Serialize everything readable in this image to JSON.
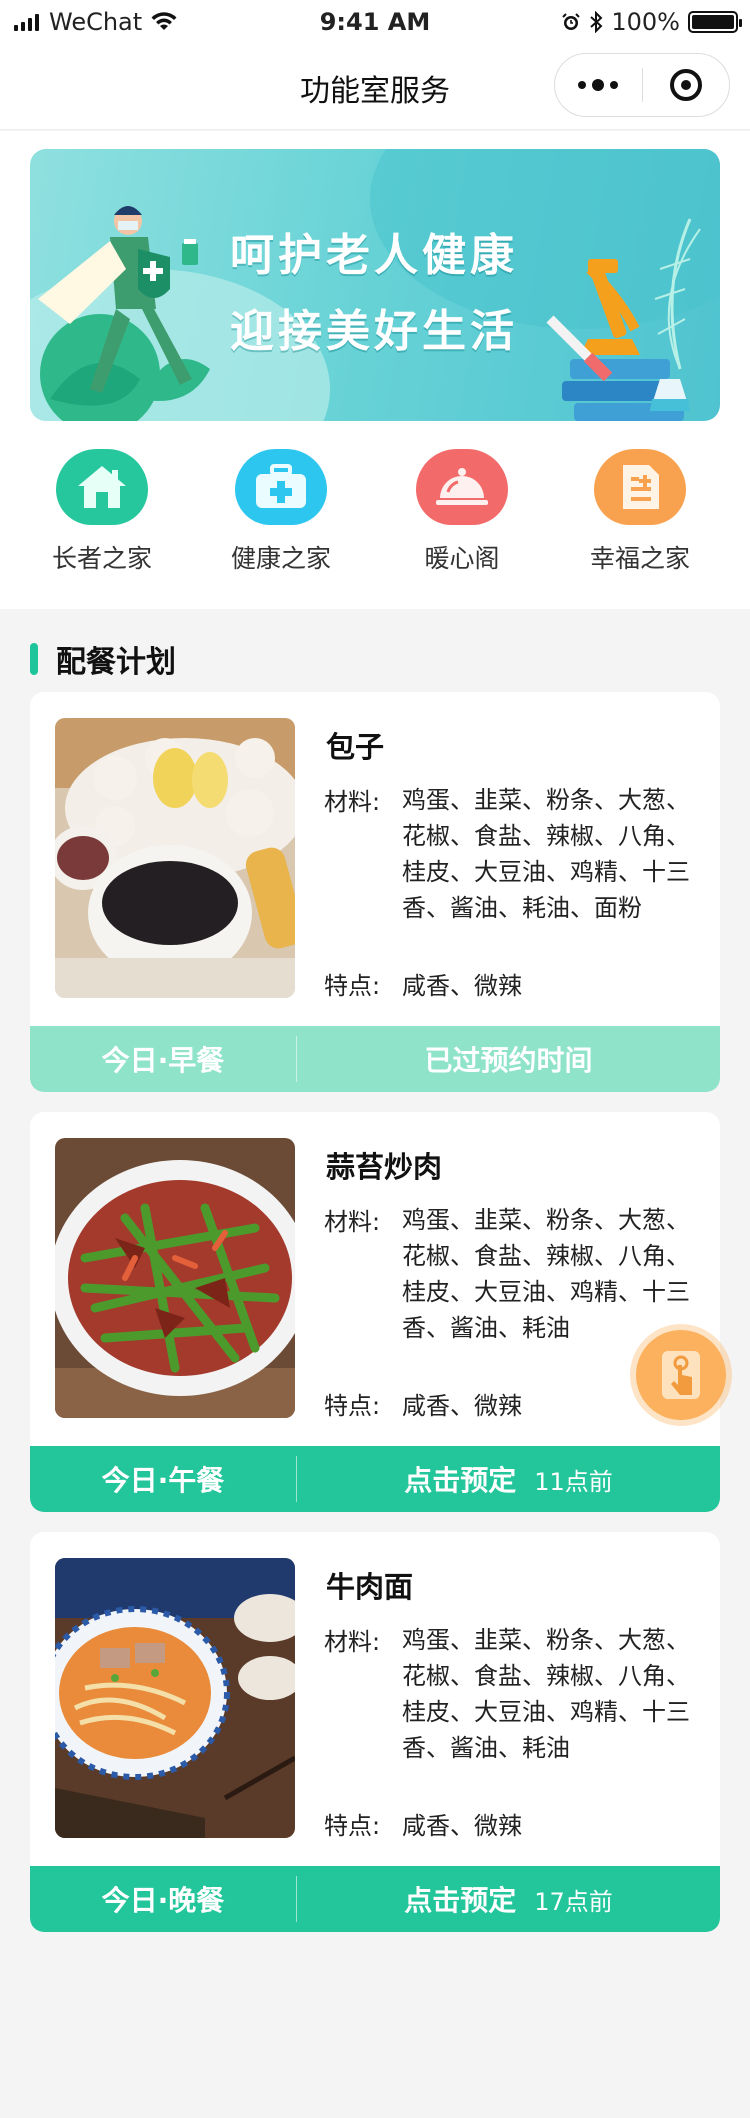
{
  "status_bar": {
    "carrier": "WeChat",
    "time": "9:41 AM",
    "battery": "100%",
    "battery_level": 1.0
  },
  "nav": {
    "title": "功能室服务"
  },
  "banner": {
    "line1": "呵护老人健康",
    "line2": "迎接美好生活"
  },
  "categories": [
    {
      "label": "长者之家",
      "icon": "house-icon",
      "color": "#26c79c"
    },
    {
      "label": "健康之家",
      "icon": "first-aid-kit-icon",
      "color": "#2cc6ee"
    },
    {
      "label": "暖心阁",
      "icon": "food-cloche-icon",
      "color": "#f36a6a"
    },
    {
      "label": "幸福之家",
      "icon": "document-list-icon",
      "color": "#f8a24f"
    }
  ],
  "section": {
    "title": "配餐计划"
  },
  "meals": [
    {
      "name": "包子",
      "materials_label": "材料:",
      "materials": "鸡蛋、韭菜、粉条、大葱、花椒、食盐、辣椒、八角、桂皮、大豆油、鸡精、十三香、酱油、耗油、面粉",
      "features_label": "特点:",
      "features": "咸香、微辣",
      "meal_time": "今日·早餐",
      "action": "已过预约时间",
      "deadline": "",
      "state": "past"
    },
    {
      "name": "蒜苔炒肉",
      "materials_label": "材料:",
      "materials": "鸡蛋、韭菜、粉条、大葱、花椒、食盐、辣椒、八角、桂皮、大豆油、鸡精、十三香、酱油、耗油",
      "features_label": "特点:",
      "features": "咸香、微辣",
      "meal_time": "今日·午餐",
      "action": "点击预定",
      "deadline": "11点前",
      "state": "active"
    },
    {
      "name": "牛肉面",
      "materials_label": "材料:",
      "materials": "鸡蛋、韭菜、粉条、大葱、花椒、食盐、辣椒、八角、桂皮、大豆油、鸡精、十三香、酱油、耗油",
      "features_label": "特点:",
      "features": "咸香、微辣",
      "meal_time": "今日·晚餐",
      "action": "点击预定",
      "deadline": "17点前",
      "state": "active"
    }
  ],
  "colors": {
    "accent": "#22c69a",
    "accent_disabled": "#8fe3c9",
    "float_button": "#fbb15d"
  }
}
